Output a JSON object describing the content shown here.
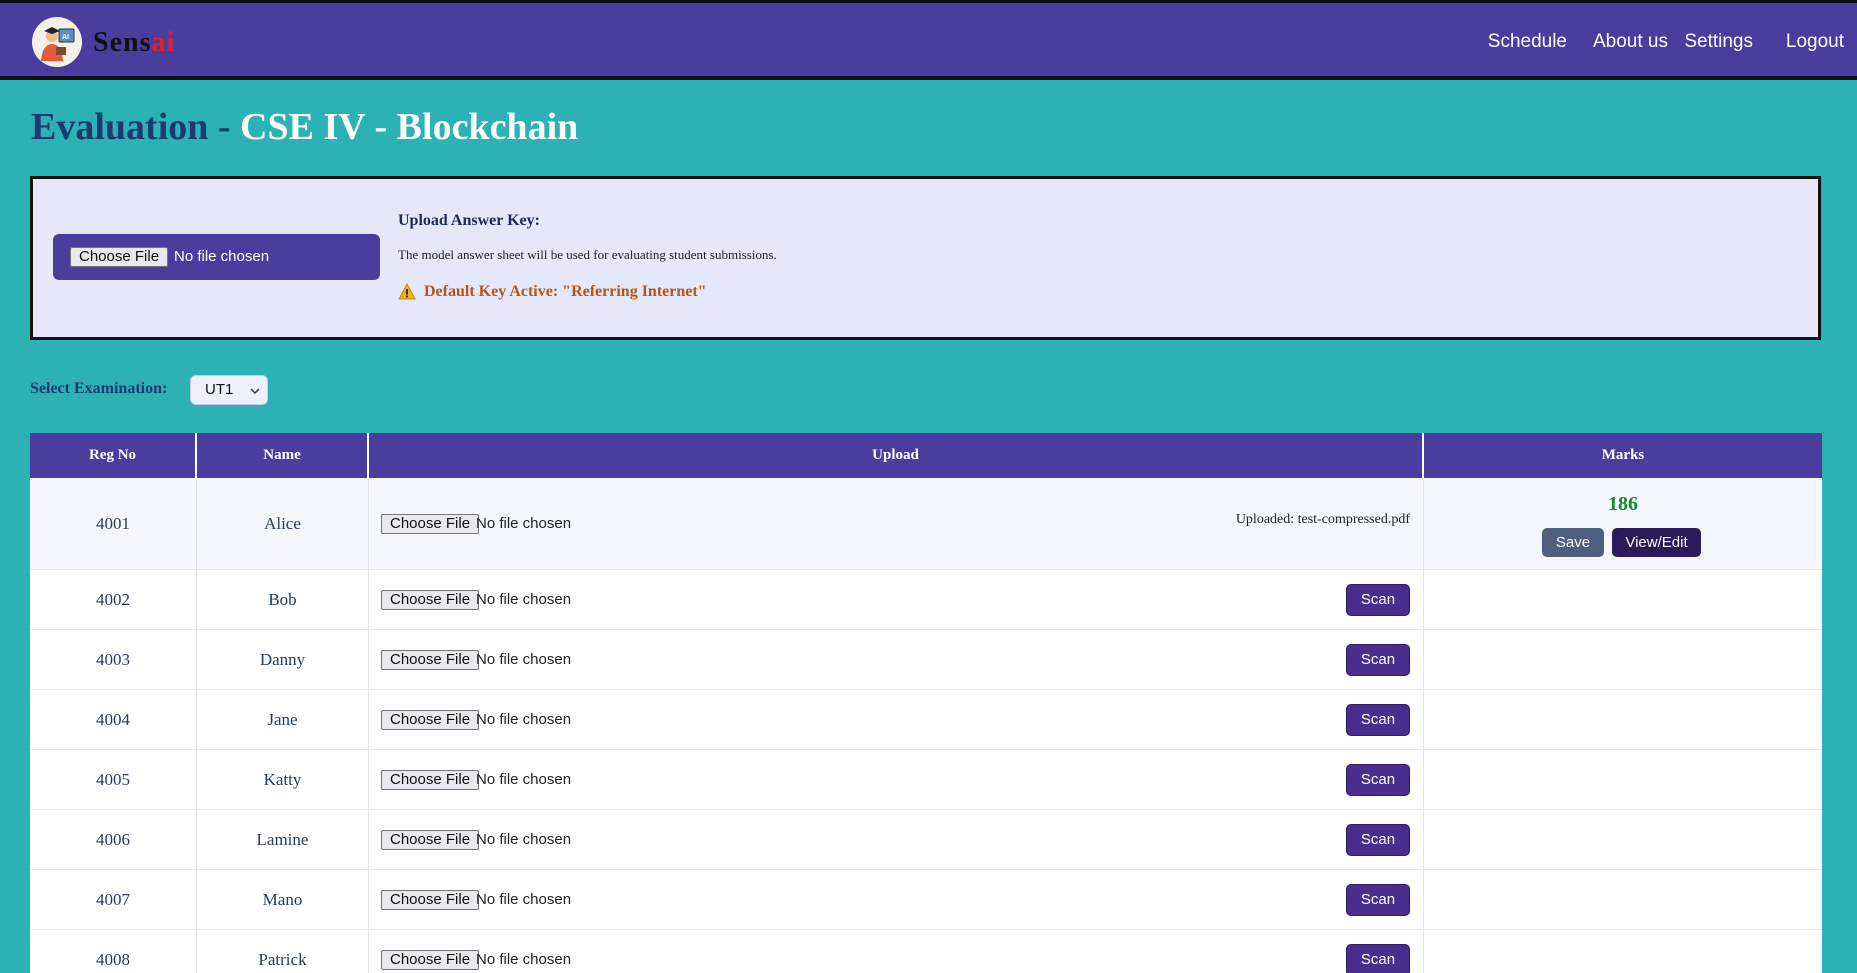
{
  "brand": {
    "part1": "Sens",
    "part2": "ai"
  },
  "nav": {
    "items": [
      {
        "label": "Schedule"
      },
      {
        "label": "About us"
      },
      {
        "label": "Settings"
      },
      {
        "label": "Logout"
      }
    ]
  },
  "title": {
    "prefix": "Evaluation - ",
    "course": "CSE IV - Blockchain"
  },
  "answer_key": {
    "choose_label": "Choose File",
    "file_status": "No file chosen",
    "heading": "Upload Answer Key:",
    "description": "The model answer sheet will be used for evaluating student submissions.",
    "warning": "Default Key Active: \"Referring Internet\"",
    "warning_color": "#b4541a"
  },
  "exam": {
    "label": "Select Examination:",
    "selected": "UT1"
  },
  "table": {
    "headers": {
      "reg": "Reg No",
      "name": "Name",
      "upload": "Upload",
      "marks": "Marks"
    },
    "choose_label": "Choose File",
    "no_file": "No file chosen",
    "scan_label": "Scan",
    "save_label": "Save",
    "view_label": "View/Edit",
    "rows": [
      {
        "reg": "4001",
        "name": "Alice",
        "uploaded": "Uploaded: test-compressed.pdf",
        "marks": "186"
      },
      {
        "reg": "4002",
        "name": "Bob"
      },
      {
        "reg": "4003",
        "name": "Danny"
      },
      {
        "reg": "4004",
        "name": "Jane"
      },
      {
        "reg": "4005",
        "name": "Katty"
      },
      {
        "reg": "4006",
        "name": "Lamine"
      },
      {
        "reg": "4007",
        "name": "Mano"
      },
      {
        "reg": "4008",
        "name": "Patrick"
      }
    ]
  },
  "colors": {
    "nav_bg": "#4a3d9e",
    "page_bg": "#2cb2b4",
    "scan_bg": "#4a2e8e",
    "marks_green": "#108a2c"
  }
}
